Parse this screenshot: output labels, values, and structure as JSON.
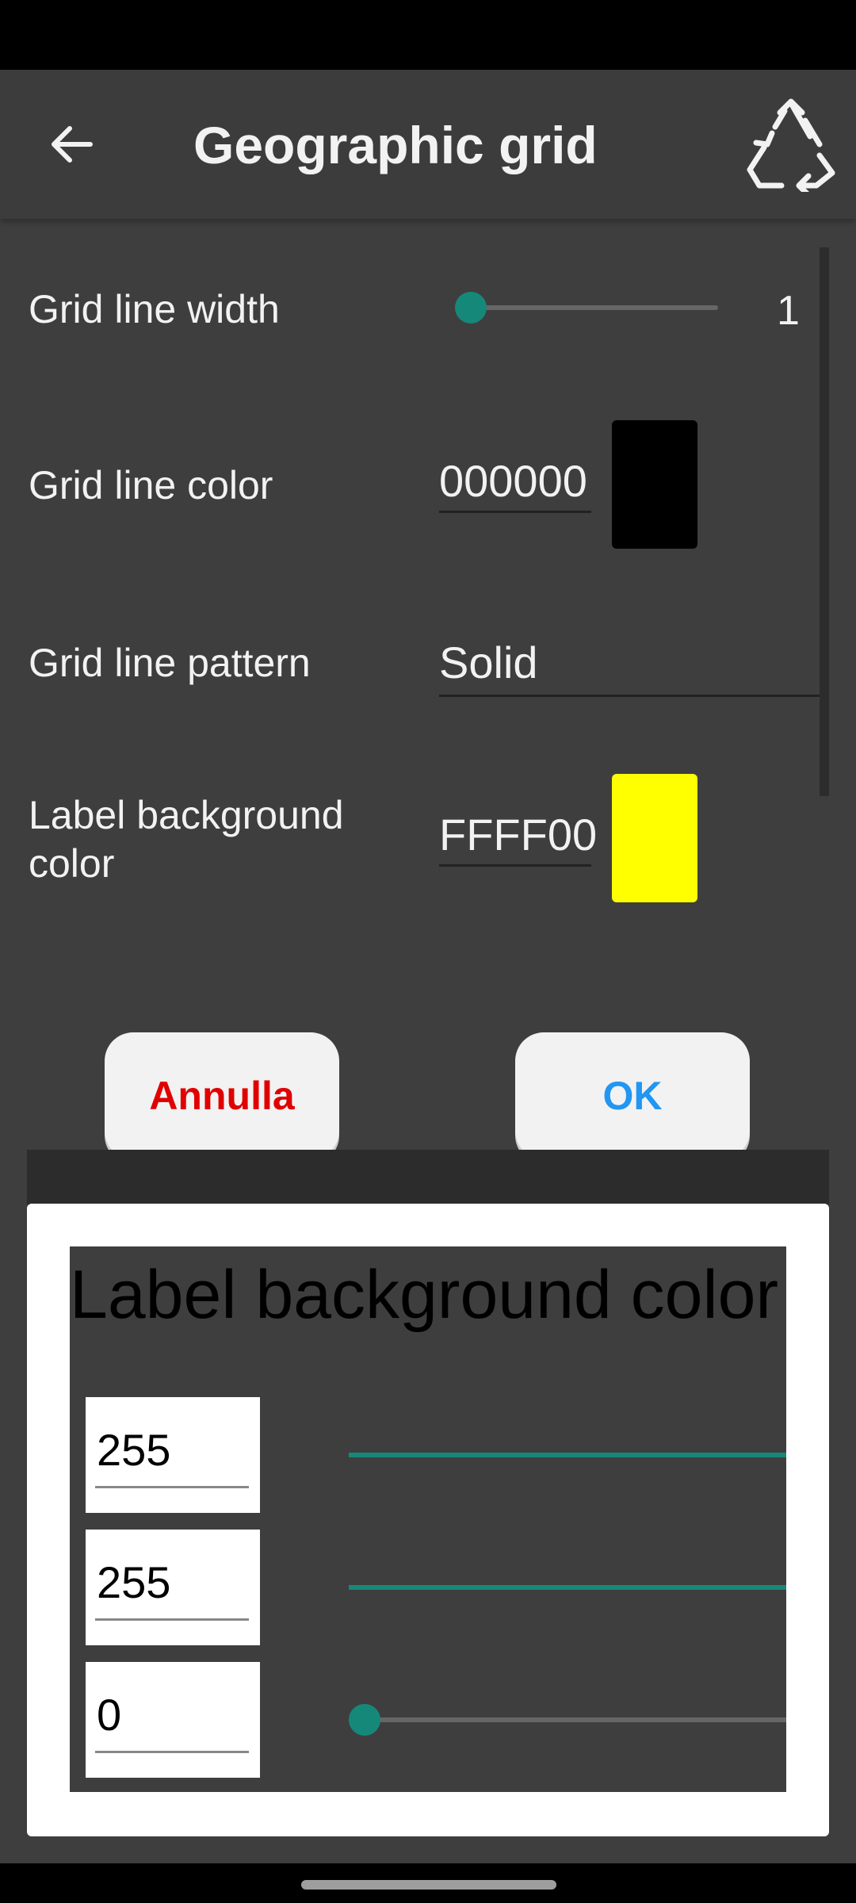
{
  "app_bar": {
    "title": "Geographic grid",
    "back_icon": "arrow-left-icon",
    "action_icon": "recycle-icon"
  },
  "settings": {
    "line_width": {
      "label": "Grid line width",
      "value": "1",
      "slider_fraction": 0.0
    },
    "line_color": {
      "label": "Grid line color",
      "hex": "000000",
      "swatch": "#000000"
    },
    "line_pattern": {
      "label": "Grid line pattern",
      "value": "Solid"
    },
    "label_bg": {
      "label": "Label background color",
      "hex": "FFFF00",
      "swatch": "#ffff00"
    }
  },
  "buttons": {
    "cancel": "Annulla",
    "ok": "OK"
  },
  "dialog": {
    "title": "Label background color",
    "channels": [
      {
        "value": "255",
        "fraction": 1.0
      },
      {
        "value": "255",
        "fraction": 1.0
      },
      {
        "value": "0",
        "fraction": 0.0
      }
    ]
  },
  "colors": {
    "accent": "#16887a",
    "cancel": "#e00000",
    "ok": "#2196f3"
  }
}
